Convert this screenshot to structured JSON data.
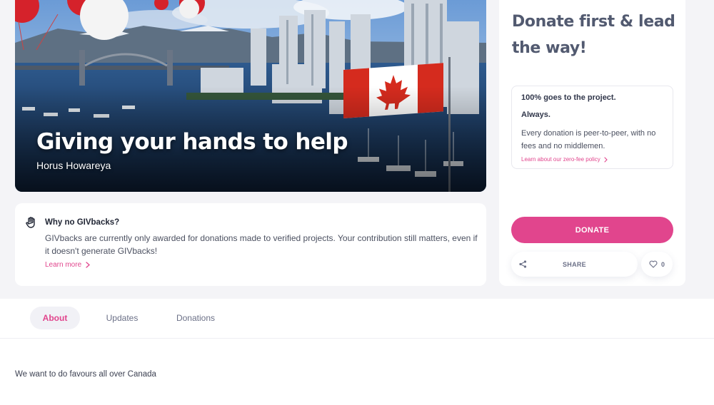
{
  "hero": {
    "title": "Giving your hands to help",
    "author": "Horus Howareya"
  },
  "givbacks": {
    "heading": "Why no GIVbacks?",
    "body": "GIVbacks are currently only awarded for donations made to verified projects. Your contribution still matters, even if it doesn't generate GIVbacks!",
    "link": "Learn more",
    "icon": "raised-hand-icon"
  },
  "donate_panel": {
    "heading": "Donate first & lead the way!",
    "policy": {
      "line1": "100% goes to the project.",
      "line2": "Always.",
      "body": "Every donation is peer-to-peer, with no fees and no middlemen.",
      "link": "Learn about our zero-fee policy"
    },
    "donate_label": "DONATE",
    "share_label": "SHARE",
    "like_count": "0"
  },
  "tabs": [
    {
      "label": "About",
      "active": true
    },
    {
      "label": "Updates",
      "active": false
    },
    {
      "label": "Donations",
      "active": false
    }
  ],
  "description": "We want to do favours all over Canada",
  "colors": {
    "accent": "#e1458d",
    "page_background": "#f4f4f7",
    "heading_text": "#525a70",
    "flag_red": "#d52b1e"
  }
}
